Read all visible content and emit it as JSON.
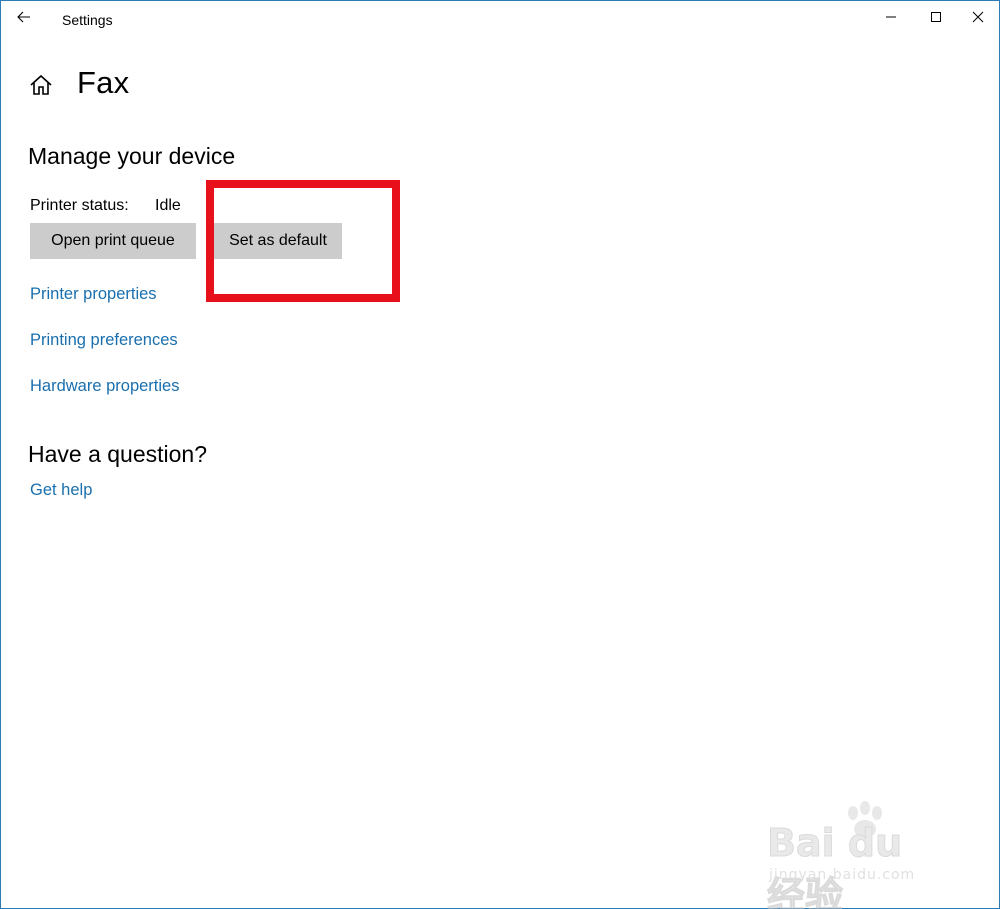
{
  "window": {
    "title": "Settings"
  },
  "page": {
    "title": "Fax"
  },
  "manage_section": {
    "heading": "Manage your device",
    "status_label": "Printer status:",
    "status_value": "Idle",
    "open_queue_label": "Open print queue",
    "set_default_label": "Set as default",
    "links": [
      "Printer properties",
      "Printing preferences",
      "Hardware properties"
    ]
  },
  "question_section": {
    "heading": "Have a question?",
    "help_link": "Get help"
  },
  "annotation": {
    "highlight_color": "#e8101a"
  },
  "watermark": {
    "main": "Bai du 经验",
    "sub": "jingyan.baidu.com"
  },
  "colors": {
    "link": "#1a6fae",
    "button_bg": "#cccccc",
    "window_border": "#2b7bb5"
  }
}
